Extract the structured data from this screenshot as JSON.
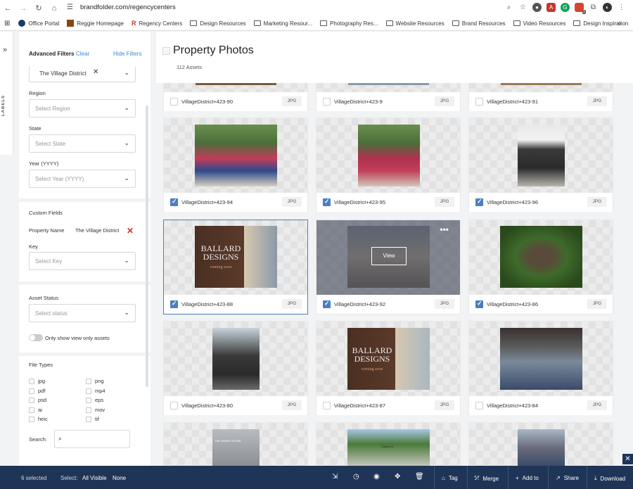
{
  "browser": {
    "url": "brandfolder.com/regencycenters",
    "bookmarks": [
      "Office Portal",
      "Reggie Homepage",
      "Regency Centers",
      "Design Resources",
      "Marketing Resour...",
      "Photography Res...",
      "Website Resources",
      "Brand Resources",
      "Video Resources",
      "Design Inspiration"
    ],
    "extension_badge": "1"
  },
  "rail": {
    "label": "LABELS"
  },
  "filters": {
    "title": "Advanced Filters",
    "clear": "Clear",
    "hide": "Hide Filters",
    "selected_value": "The Village District",
    "region_label": "Region",
    "region_placeholder": "Select Region",
    "state_label": "State",
    "state_placeholder": "Select State",
    "year_label": "Year (YYYY)",
    "year_placeholder": "Select Year (YYYY)",
    "custom_fields_label": "Custom Fields",
    "property_name_label": "Property Name",
    "property_name_value": "The Village District",
    "key_label": "Key",
    "key_placeholder": "Select Key",
    "asset_status_label": "Asset Status",
    "status_placeholder": "Select status",
    "toggle_label": "Only show view only assets",
    "file_types_label": "File Types",
    "file_types_left": [
      "jpg",
      "pdf",
      "psd",
      "ai",
      "heic"
    ],
    "file_types_right": [
      "png",
      "mp4",
      "eps",
      "mov",
      "tif"
    ],
    "search_label": "Search:"
  },
  "main": {
    "title": "Property Photos",
    "asset_count": "112 Assets",
    "cards": [
      {
        "name": "VillageDistrict+423-90",
        "ext": "JPG",
        "checked": false
      },
      {
        "name": "VillageDistrict+423-9",
        "ext": "JPG",
        "checked": false
      },
      {
        "name": "VillageDistrict+423-91",
        "ext": "JPG",
        "checked": false
      },
      {
        "name": "VillageDistrict+423-94",
        "ext": "JPG",
        "checked": true
      },
      {
        "name": "VillageDistrict+423-95",
        "ext": "JPG",
        "checked": true
      },
      {
        "name": "VillageDistrict+423-96",
        "ext": "JPG",
        "checked": true
      },
      {
        "name": "VillageDistrict+423-88",
        "ext": "JPG",
        "checked": true
      },
      {
        "name": "VillageDistrict+423-92",
        "ext": "JPG",
        "checked": true
      },
      {
        "name": "VillageDistrict+423-86",
        "ext": "JPG",
        "checked": true
      },
      {
        "name": "VillageDistrict+423-80",
        "ext": "JPG",
        "checked": false
      },
      {
        "name": "VillageDistrict+423-87",
        "ext": "JPG",
        "checked": false
      },
      {
        "name": "VillageDistrict+423-84",
        "ext": "JPG",
        "checked": false
      }
    ],
    "view_button": "View",
    "ballard_line1": "BALLARD",
    "ballard_line2": "DESIGNS",
    "ballard_line3": "coming soon",
    "shade_store_sign": "THE SHADE STORE",
    "storefront_sign": "Cantina X"
  },
  "bottom_bar": {
    "selected": "6 selected",
    "select_label": "Select:",
    "all_visible": "All Visible",
    "none": "None",
    "tag": "Tag",
    "merge": "Merge",
    "add_to": "Add to",
    "share": "Share",
    "download": "Download"
  },
  "colors": {
    "accent": "#4a7fc1",
    "bar": "#1f3557",
    "link": "#3a8ad6",
    "remove": "#c0392b"
  }
}
